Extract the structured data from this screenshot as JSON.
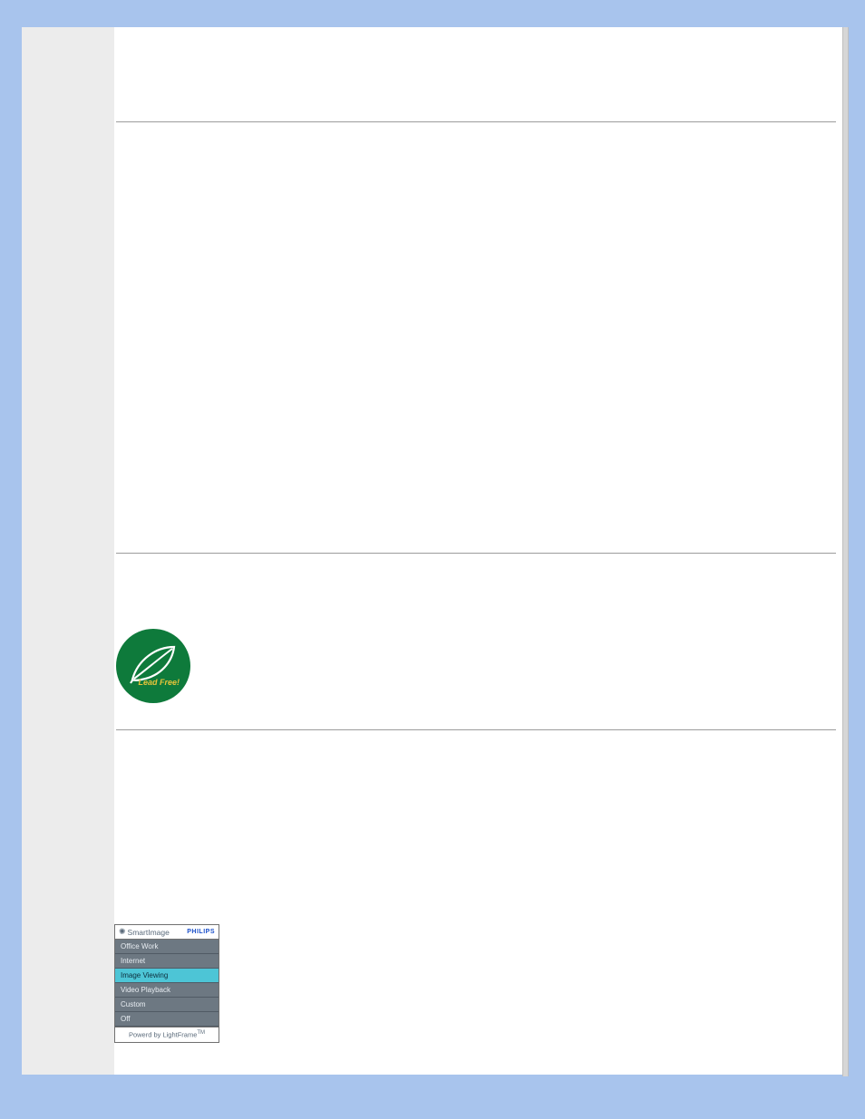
{
  "leafBadge": {
    "label": "Lead Free!"
  },
  "smartImage": {
    "headerTitle": "SmartImage",
    "headerBrand": "PHILIPS",
    "items": [
      {
        "label": "Office Work",
        "selected": false
      },
      {
        "label": "Internet",
        "selected": false
      },
      {
        "label": "Image Viewing",
        "selected": true
      },
      {
        "label": "Video Playback",
        "selected": false
      },
      {
        "label": "Custom",
        "selected": false
      },
      {
        "label": "Off",
        "selected": false
      }
    ],
    "footer": "Powerd by LightFrame",
    "footerSup": "TM"
  }
}
